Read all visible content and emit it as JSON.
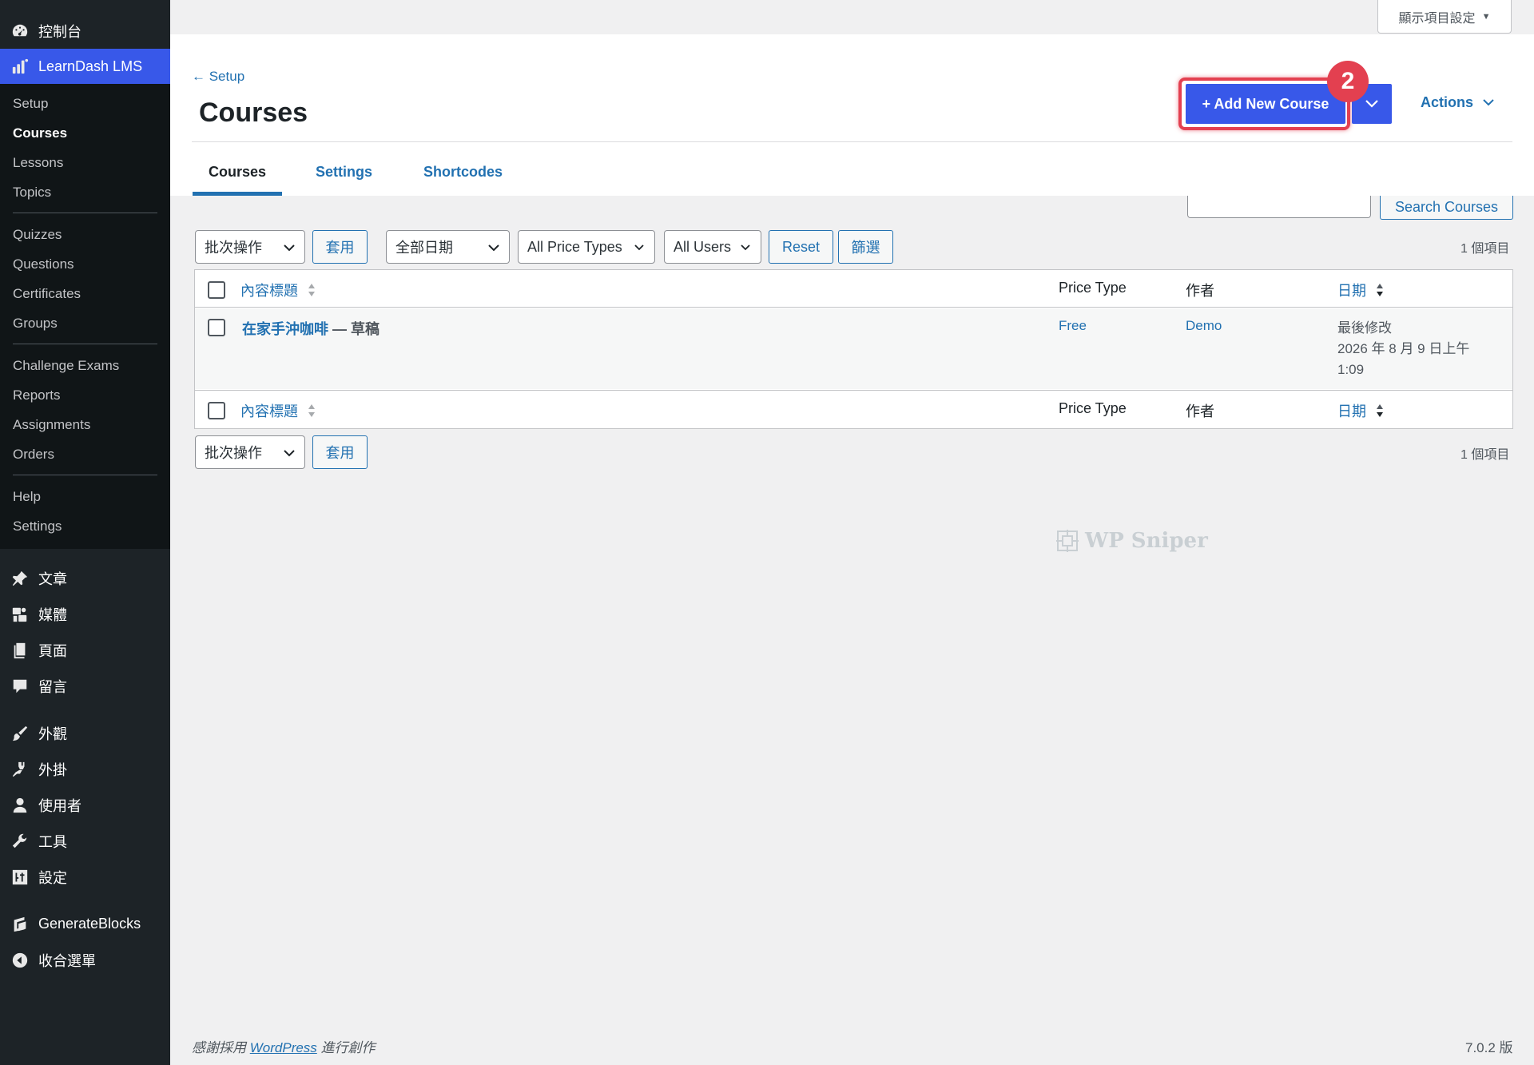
{
  "sidebar": {
    "dashboard": "控制台",
    "learndash": "LearnDash LMS",
    "submenu": [
      "Setup",
      "Courses",
      "Lessons",
      "Topics",
      "Quizzes",
      "Questions",
      "Certificates",
      "Groups",
      "Challenge Exams",
      "Reports",
      "Assignments",
      "Orders",
      "Help",
      "Settings"
    ],
    "posts": "文章",
    "media": "媒體",
    "pages": "頁面",
    "comments": "留言",
    "appearance": "外觀",
    "plugins": "外掛",
    "users": "使用者",
    "tools": "工具",
    "settings": "設定",
    "generateblocks": "GenerateBlocks",
    "collapse": "收合選單"
  },
  "screen_options": "顯示項目設定",
  "header": {
    "back_link": "← Setup",
    "title": "Courses",
    "add_new": "+ Add New Course",
    "badge": "2",
    "actions": "Actions",
    "tabs": [
      "Courses",
      "Settings",
      "Shortcodes"
    ]
  },
  "search": {
    "button": "Search Courses"
  },
  "filters": {
    "bulk_action": "批次操作",
    "apply": "套用",
    "dates": "全部日期",
    "price_types": "All Price Types",
    "users": "All Users",
    "reset": "Reset",
    "filter": "篩選",
    "count": "1 個項目"
  },
  "table": {
    "columns": {
      "title": "內容標題",
      "price_type": "Price Type",
      "author": "作者",
      "date": "日期"
    },
    "rows": [
      {
        "title": "在家手沖咖啡",
        "state": " — 草稿",
        "price_type": "Free",
        "author": "Demo",
        "date_label": "最後修改",
        "date_value": "2026 年 8 月 9 日上午",
        "time": "1:09"
      }
    ]
  },
  "watermark": "WP Sniper",
  "footer": {
    "thanks_prefix": "感謝採用 ",
    "thanks_link": "WordPress",
    "thanks_suffix": " 進行創作",
    "version": "7.0.2 版"
  },
  "colors": {
    "accent": "#3858e9",
    "link": "#2271b1",
    "highlight": "#e34050",
    "sidebar": "#1d2327"
  }
}
